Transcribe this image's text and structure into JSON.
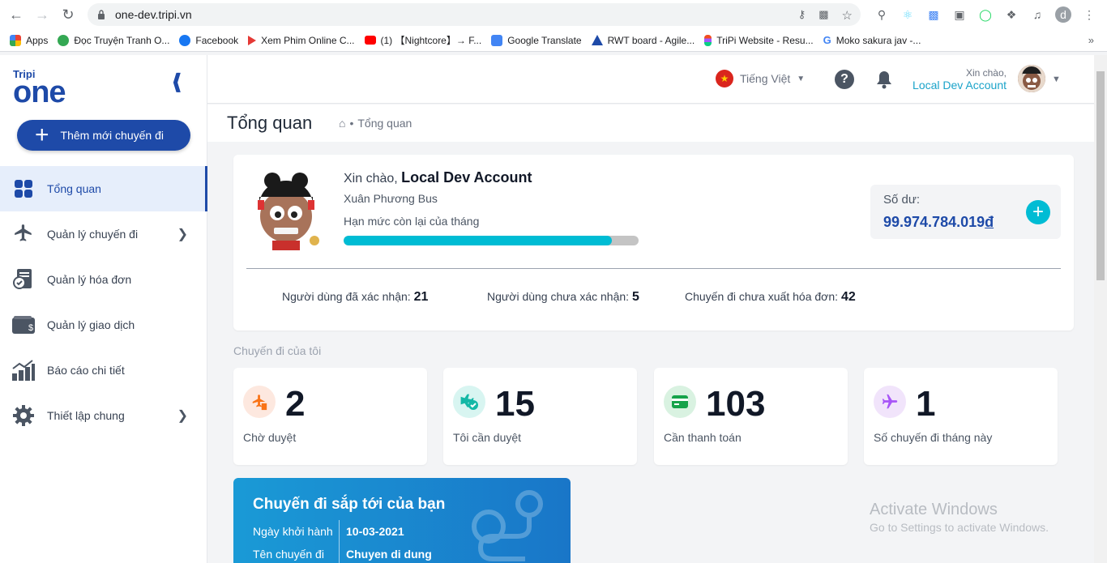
{
  "browser": {
    "url": "one-dev.tripi.vn",
    "bookmarks": [
      {
        "label": "Apps",
        "color": "#ea4335"
      },
      {
        "label": "Đọc Truyện Tranh O...",
        "color": "#34a853"
      },
      {
        "label": "Facebook",
        "color": "#1877f2"
      },
      {
        "label": "Xem Phim Online C...",
        "color": "#e53935"
      },
      {
        "label": "(1) 【Nightcore】→ F...",
        "color": "#ff0000"
      },
      {
        "label": "Google Translate",
        "color": "#4285f4"
      },
      {
        "label": "RWT board - Agile...",
        "color": "#1e4aa8"
      },
      {
        "label": "TriPi Website - Resu...",
        "color": "#f24e1e"
      },
      {
        "label": "Moko sakura jav -...",
        "color": "#4285f4"
      }
    ],
    "profile_initial": "d"
  },
  "sidebar": {
    "logo_top": "Tripi",
    "logo_main": "one",
    "add_button": "Thêm mới chuyến đi",
    "items": [
      {
        "label": "Tổng quan",
        "icon": "dashboard-icon"
      },
      {
        "label": "Quản lý chuyến đi",
        "icon": "plane-icon"
      },
      {
        "label": "Quản lý hóa đơn",
        "icon": "invoice-icon"
      },
      {
        "label": "Quản lý giao dịch",
        "icon": "wallet-icon"
      },
      {
        "label": "Báo cáo chi tiết",
        "icon": "chart-icon"
      },
      {
        "label": "Thiết lập chung",
        "icon": "gear-icon"
      }
    ]
  },
  "header": {
    "language": "Tiếng Việt",
    "greeting": "Xin chào,",
    "user": "Local Dev Account"
  },
  "page": {
    "title": "Tổng quan",
    "breadcrumb": "Tổng quan"
  },
  "welcome": {
    "hello": "Xin chào,",
    "name": "Local Dev Account",
    "company": "Xuân Phương Bus",
    "limit_label": "Hạn mức còn lại của tháng",
    "limit_fraction": 0.91,
    "balance_label": "Số dư:",
    "balance_value": "99.974.784.019",
    "currency": "đ",
    "stats": [
      {
        "label": "Người dùng đã xác nhận:",
        "value": "21"
      },
      {
        "label": "Người dùng chưa xác nhận:",
        "value": "5"
      },
      {
        "label": "Chuyến đi chưa xuất hóa đơn:",
        "value": "42"
      }
    ]
  },
  "trips": {
    "section_title": "Chuyến đi của tôi",
    "tiles": [
      {
        "value": "2",
        "label": "Chờ duyệt",
        "color": "#f97316",
        "bg": "#fde8df"
      },
      {
        "value": "15",
        "label": "Tôi cần duyệt",
        "color": "#14b8a6",
        "bg": "#d8f5f1"
      },
      {
        "value": "103",
        "label": "Cần thanh toán",
        "color": "#16a34a",
        "bg": "#d9f2e1"
      },
      {
        "value": "1",
        "label": "Số chuyến đi tháng này",
        "color": "#a855f7",
        "bg": "#f1e4fb"
      }
    ]
  },
  "upcoming": {
    "title": "Chuyến đi sắp tới của bạn",
    "start_label": "Ngày khởi hành",
    "start_value": "10-03-2021",
    "name_label": "Tên chuyến đi",
    "name_value": "Chuyen di dung"
  },
  "watermark": {
    "line1": "Activate Windows",
    "line2": "Go to Settings to activate Windows."
  }
}
